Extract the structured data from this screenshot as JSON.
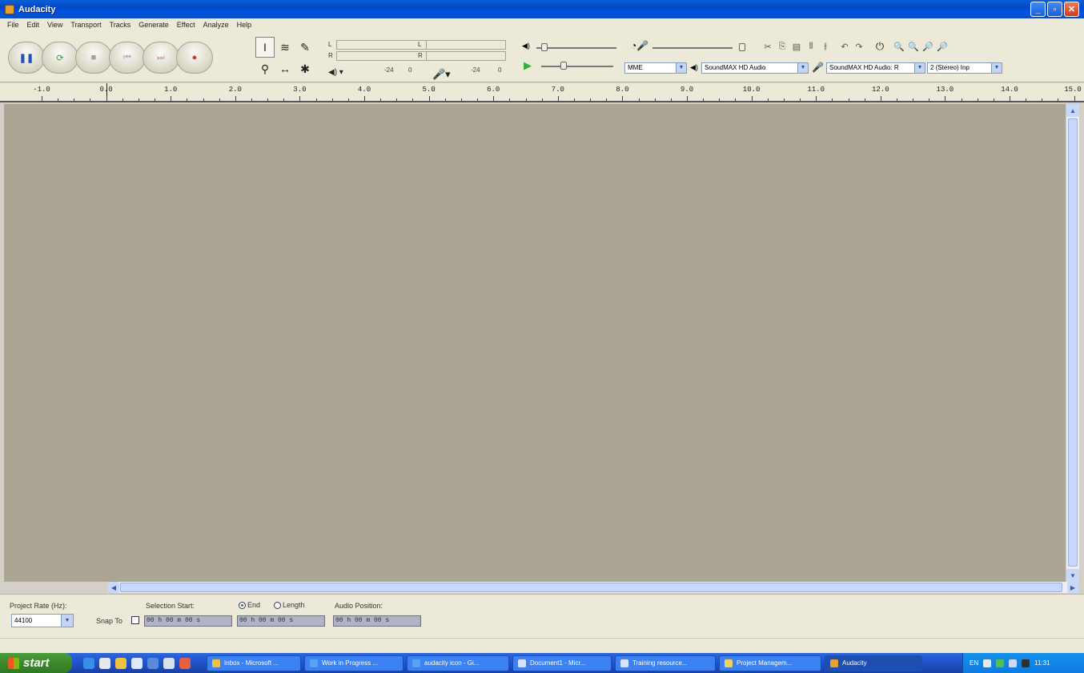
{
  "window": {
    "title": "Audacity",
    "buttons": [
      "_",
      "▫",
      "✕"
    ]
  },
  "menu": [
    "File",
    "Edit",
    "View",
    "Transport",
    "Tracks",
    "Generate",
    "Effect",
    "Analyze",
    "Help"
  ],
  "transport": {
    "buttons": [
      {
        "name": "pause-button",
        "glyph": "❚❚"
      },
      {
        "name": "play-button",
        "glyph": "⟳"
      },
      {
        "name": "stop-button",
        "glyph": "■"
      },
      {
        "name": "skip-start-button",
        "glyph": "⏮"
      },
      {
        "name": "skip-end-button",
        "glyph": "⏭"
      },
      {
        "name": "record-button",
        "glyph": "●"
      }
    ]
  },
  "tools": [
    "I",
    "≋",
    "✎",
    "⚲",
    "↔",
    "✱"
  ],
  "meters": {
    "playback": {
      "l": "L",
      "r": "R",
      "scale": [
        "-24",
        "0"
      ]
    },
    "record": {
      "l": "L",
      "r": "R",
      "scale": [
        "-24",
        "0"
      ]
    }
  },
  "device": {
    "host": "MME",
    "output": "SoundMAX HD Audio",
    "input": "SoundMAX HD Audio: R",
    "channels": "2 (Stereo) Inp"
  },
  "ruler": {
    "ticks": [
      "-1.0",
      "0.0",
      "1.0",
      "2.0",
      "3.0",
      "4.0",
      "5.0",
      "6.0",
      "7.0",
      "8.0",
      "9.0",
      "10.0",
      "11.0",
      "12.0",
      "13.0",
      "14.0",
      "15.0"
    ]
  },
  "selection": {
    "project_rate_label": "Project Rate (Hz):",
    "project_rate": "44100",
    "snap_label": "Snap To",
    "selection_start_label": "Selection Start:",
    "end_label": "End",
    "length_label": "Length",
    "audio_position_label": "Audio Position:",
    "start_time": "00 h 00 m 00 s",
    "end_time": "00 h 00 m 00 s",
    "position_time": "00 h 00 m 00 s"
  },
  "taskbar": {
    "start": "start",
    "tasks": [
      "Inbox - Microsoft ...",
      "Work in Progress ...",
      "audacity icon - Gi...",
      "Document1 - Micr...",
      "Training resource...",
      "Project Managem...",
      "Audacity"
    ],
    "tray": {
      "lang": "EN",
      "time": "11:31"
    }
  }
}
